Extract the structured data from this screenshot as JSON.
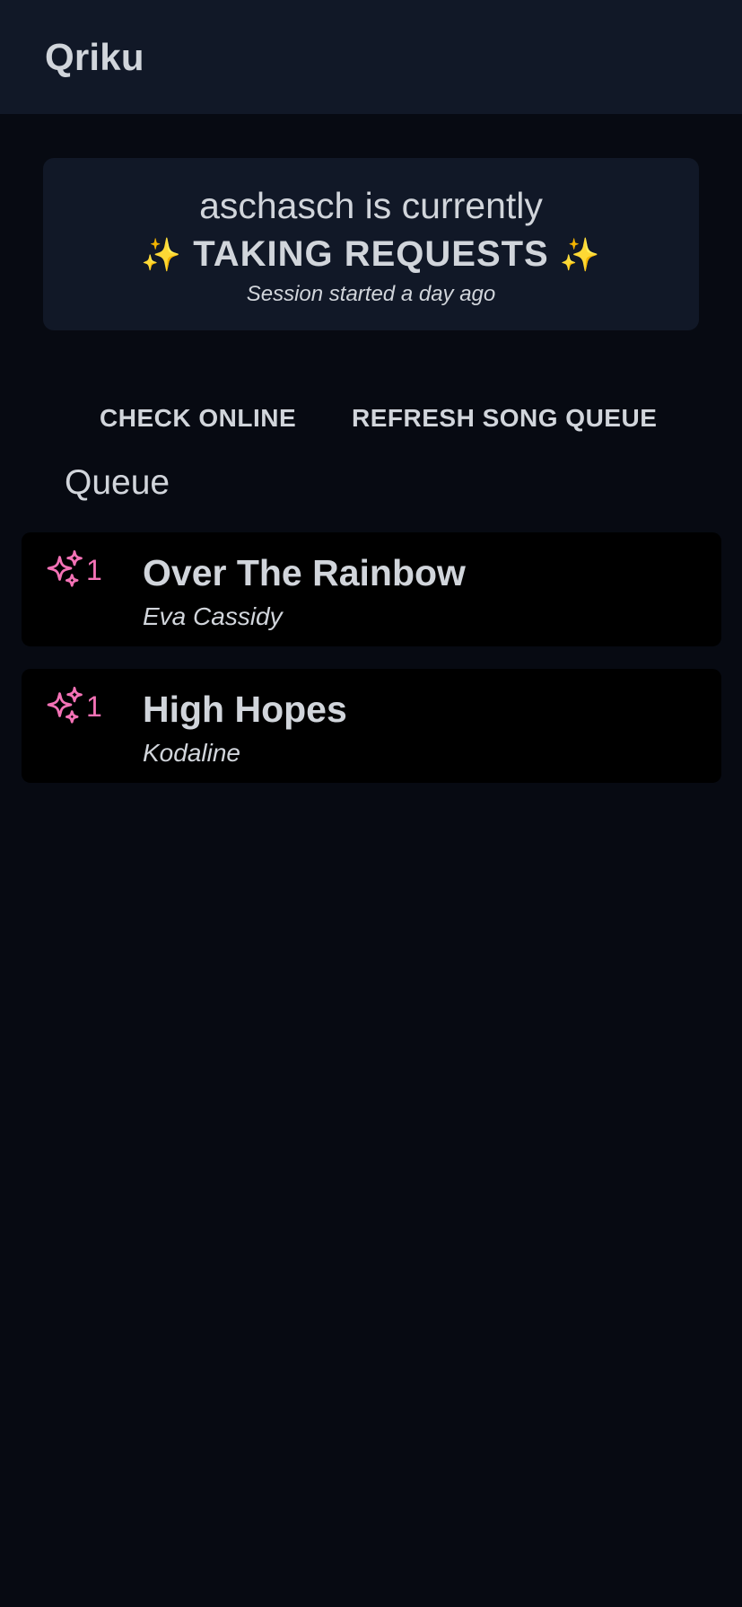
{
  "app": {
    "title": "Qriku"
  },
  "status": {
    "line1": "aschasch is currently",
    "sparkle": "✨",
    "state": "TAKING REQUESTS",
    "session": "Session started a day ago"
  },
  "actions": {
    "check_online": "CHECK ONLINE",
    "refresh_queue": "REFRESH SONG QUEUE"
  },
  "queue": {
    "heading": "Queue",
    "items": [
      {
        "title": "Over The Rainbow",
        "artist": "Eva Cassidy",
        "votes": "1",
        "icon": "sparkles-icon"
      },
      {
        "title": "High Hopes",
        "artist": "Kodaline",
        "votes": "1",
        "icon": "sparkles-icon"
      }
    ]
  },
  "colors": {
    "background": "#070a12",
    "header": "#111827",
    "card": "#111827",
    "item": "#000000",
    "text": "#d1d5db",
    "accent_pink": "#f472b6",
    "sparkle_yellow": "#facc15"
  }
}
